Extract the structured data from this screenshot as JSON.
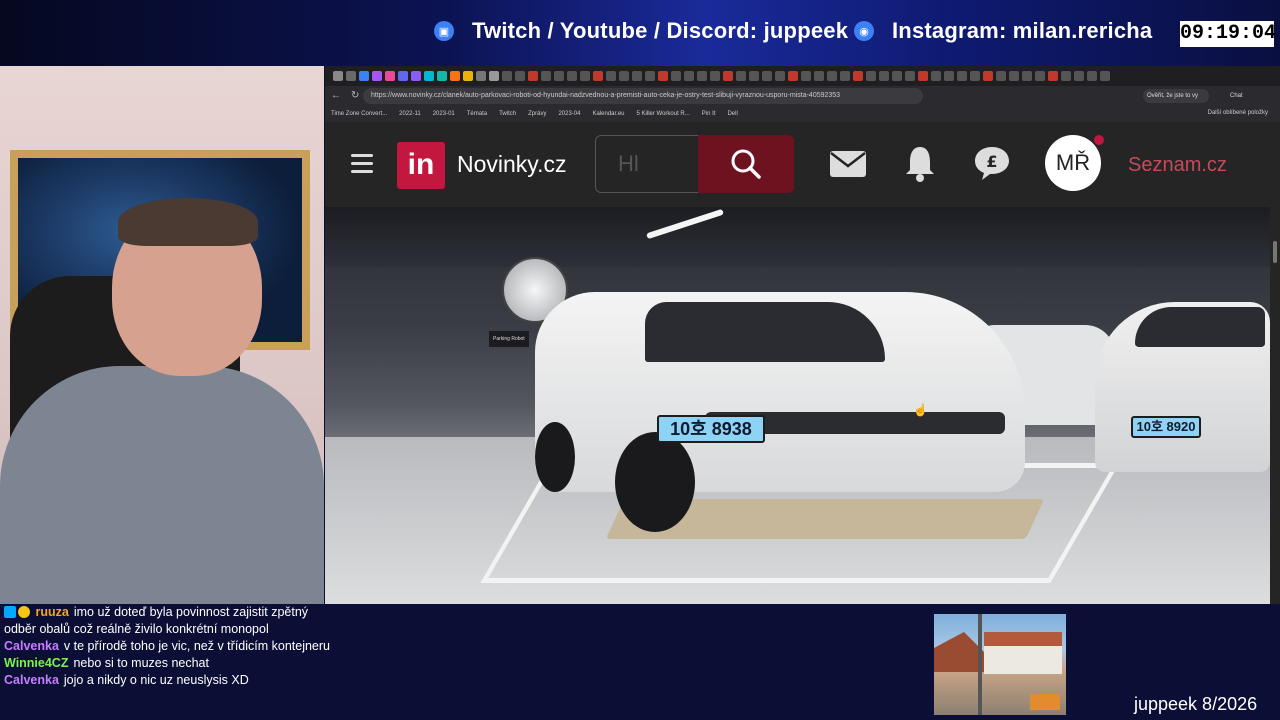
{
  "overlay": {
    "social_left": "Twitch / Youtube / Discord: juppeek",
    "social_right": "Instagram: milan.rericha",
    "clock": "09:19:04",
    "stream_label": "juppeek 8/2026"
  },
  "browser": {
    "url": "https://www.novinky.cz/clanek/auto-parkovaci-roboti-od-hyundai-nadzvednou-a-premisti-auto-ceka-je-ostry-test-slibuji-vyraznou-usporu-mista-40592353",
    "verify_label": "Ověřit, že jste to vy",
    "chat_label": "Chat",
    "bookmarks": [
      "Time Zone Convert...",
      "2022-11",
      "2023-01",
      "Témata",
      "Twitch",
      "Zprávy",
      "2023-04",
      "Kalendar.eu",
      "5 Killer Workout R...",
      "Pin It",
      "Dell"
    ],
    "other_bookmarks": "Další oblíbené položky"
  },
  "site": {
    "logo_mark": "in",
    "logo_text": "Novinky.cz",
    "search_placeholder": "Hl",
    "avatar_initials": "MŘ",
    "seznam_link": "Seznam.cz",
    "accent": "#c4173f"
  },
  "photo": {
    "plate_main": "10호 8938",
    "plate_right": "10호 8920",
    "sign": "Parking Robot"
  },
  "chat": [
    {
      "user": "ruuza",
      "color": "#f5a623",
      "text": "imo už doteď byla povinnost zajistit zpětný odběr obalů což reálně živilo konkrétní monopol",
      "badges": true
    },
    {
      "user": "Calvenka",
      "color": "#c77dff",
      "text": "v te přírodě toho je vic, než v třídicím kontejneru",
      "badges": false
    },
    {
      "user": "Winnie4CZ",
      "color": "#7cf24f",
      "text": "nebo si to muzes nechat",
      "badges": false
    },
    {
      "user": "Calvenka",
      "color": "#c77dff",
      "text": "jojo a nikdy o nic uz neuslysis XD",
      "badges": false
    }
  ]
}
